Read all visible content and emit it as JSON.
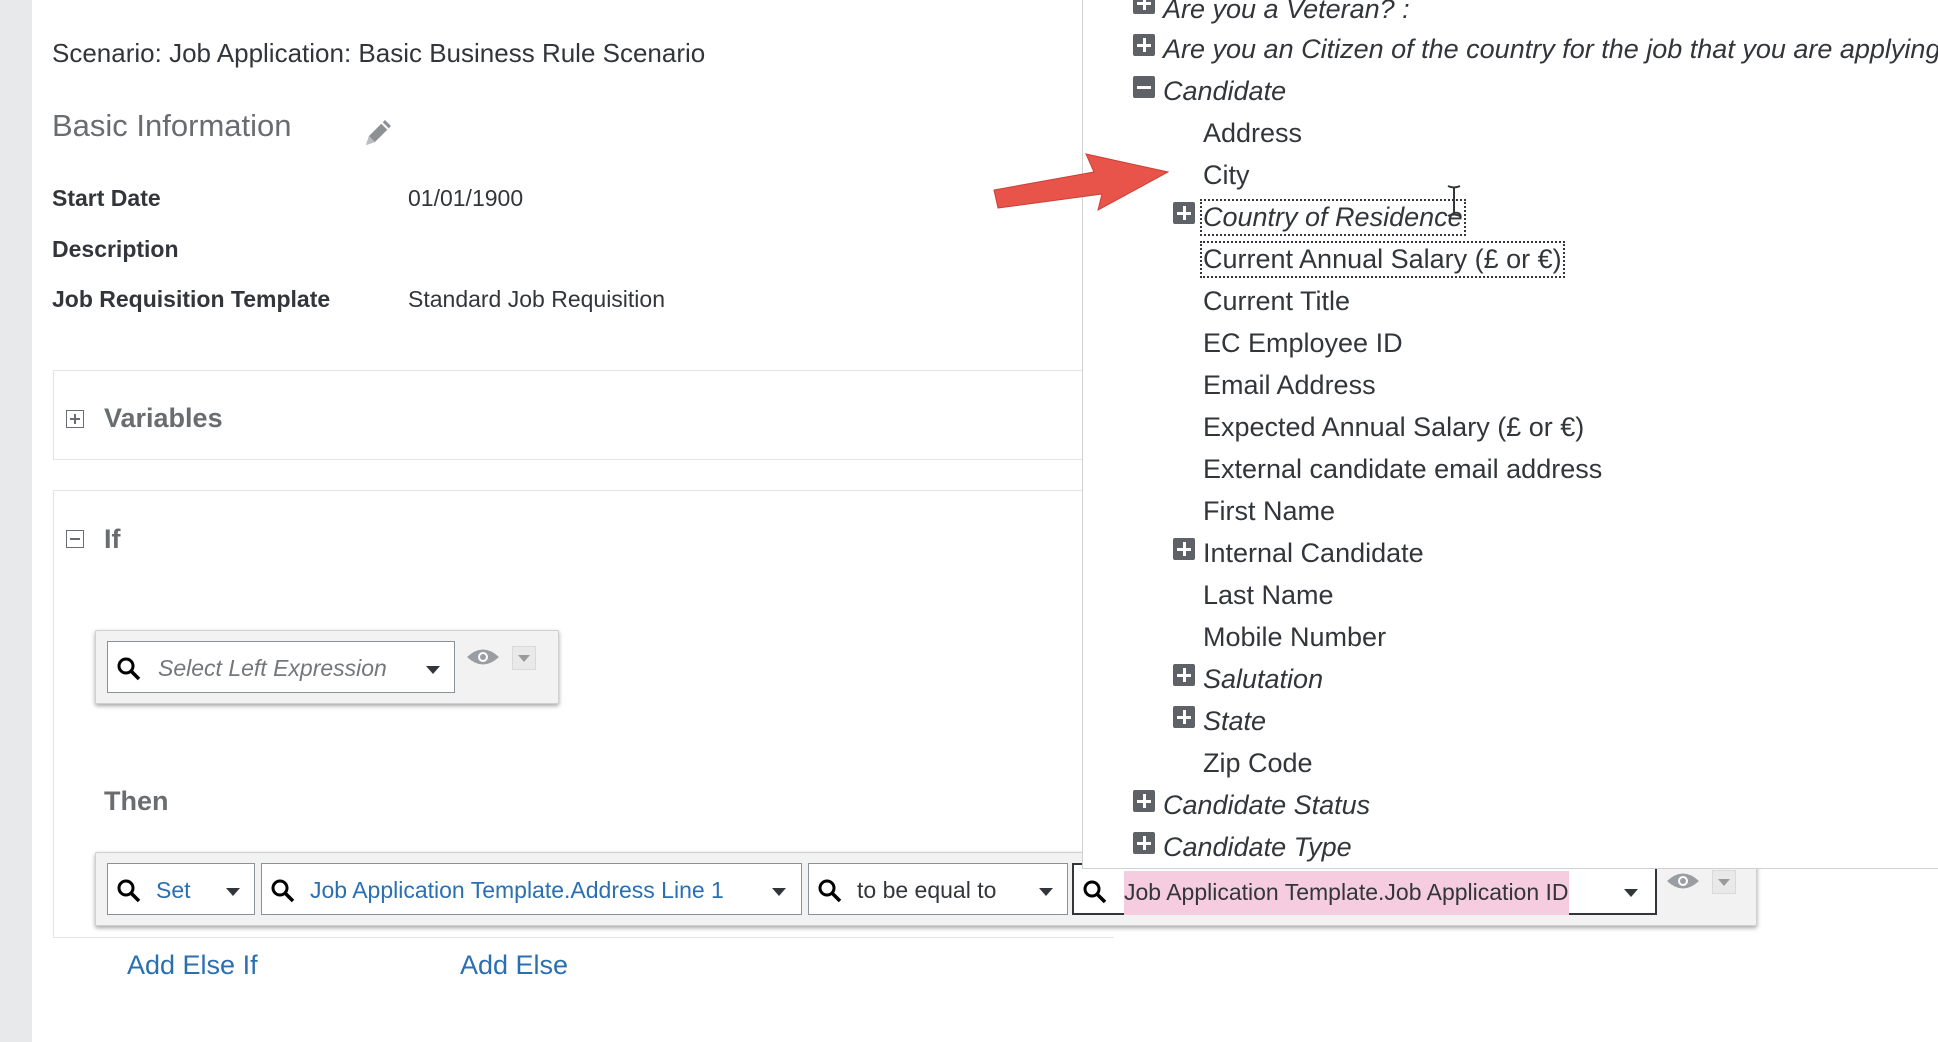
{
  "page": {
    "scenario": "Scenario: Job Application: Basic Business Rule Scenario",
    "section_title": "Basic Information"
  },
  "basic_info": {
    "start_date_label": "Start Date",
    "start_date_value": "01/01/1900",
    "description_label": "Description",
    "description_value": "",
    "template_label": "Job Requisition Template",
    "template_value": "Standard Job Requisition"
  },
  "variables": {
    "label": "Variables"
  },
  "if_block": {
    "label": "If",
    "left_expression_placeholder": "Select Left Expression",
    "then_label": "Then"
  },
  "then_row": {
    "action": "Set",
    "target": "Job Application Template.Address Line 1",
    "operator": "to be equal to",
    "value": "Job Application Template.Job Application ID"
  },
  "links": {
    "add_else_if": "Add Else If",
    "add_else": "Add Else"
  },
  "dropdown": {
    "top_items": [
      {
        "label": "Are you a Veteran? :",
        "italic": true,
        "expandable": true
      },
      {
        "label": "Are you an Citizen of the country for the job that you are applying",
        "italic": true,
        "expandable": true
      },
      {
        "label": "Candidate",
        "italic": true,
        "expandable": true,
        "expanded": true
      }
    ],
    "candidate_children": [
      {
        "label": "Address",
        "italic": false,
        "expandable": false
      },
      {
        "label": "City",
        "italic": false,
        "expandable": false
      },
      {
        "label": "Country of Residence",
        "italic": true,
        "expandable": true,
        "focused": true
      },
      {
        "label": "Current Annual Salary (£ or €)",
        "italic": false,
        "expandable": false,
        "focused": true
      },
      {
        "label": "Current Title",
        "italic": false,
        "expandable": false
      },
      {
        "label": "EC Employee ID",
        "italic": false,
        "expandable": false
      },
      {
        "label": "Email Address",
        "italic": false,
        "expandable": false
      },
      {
        "label": "Expected Annual Salary (£ or €)",
        "italic": false,
        "expandable": false
      },
      {
        "label": "External candidate email address",
        "italic": false,
        "expandable": false
      },
      {
        "label": "First Name",
        "italic": false,
        "expandable": false
      },
      {
        "label": "Internal Candidate",
        "italic": false,
        "expandable": true
      },
      {
        "label": "Last Name",
        "italic": false,
        "expandable": false
      },
      {
        "label": "Mobile Number",
        "italic": false,
        "expandable": false
      },
      {
        "label": "Salutation",
        "italic": true,
        "expandable": true
      },
      {
        "label": "State",
        "italic": true,
        "expandable": true
      },
      {
        "label": "Zip Code",
        "italic": false,
        "expandable": false
      }
    ],
    "bottom_items": [
      {
        "label": "Candidate Status",
        "italic": true,
        "expandable": true
      },
      {
        "label": "Candidate Type",
        "italic": true,
        "expandable": true
      }
    ]
  },
  "colors": {
    "arrow": "#e8544a",
    "link": "#2a6fb2",
    "highlight": "#f6cde0"
  },
  "icons": [
    "pencil-icon",
    "search-icon",
    "chevron-down-icon",
    "eye-icon",
    "plus-box-icon",
    "minus-box-icon",
    "text-cursor-icon"
  ]
}
